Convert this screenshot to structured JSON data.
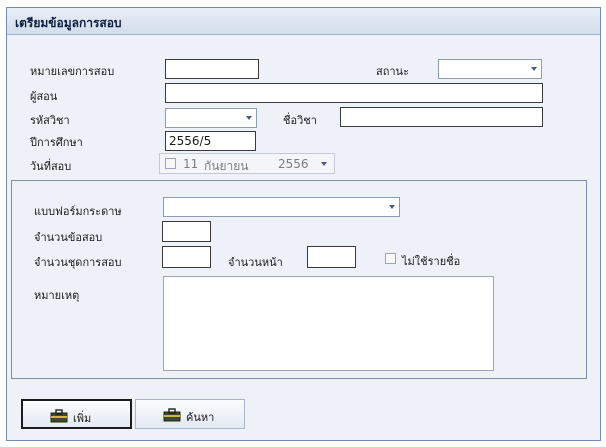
{
  "window": {
    "title": "เตรียมข้อมูลการสอบ"
  },
  "form": {
    "exam_no_label": "หมายเลขการสอบ",
    "exam_no_value": "",
    "status_label": "สถานะ",
    "status_value": "",
    "teacher_label": "ผู้สอน",
    "teacher_value": "",
    "subject_code_label": "รหัสวิชา",
    "subject_code_value": "",
    "subject_name_label": "ชื่อวิชา",
    "subject_name_value": "",
    "academic_year_label": "ปีการศึกษา",
    "academic_year_value": "2556/5",
    "exam_date_label": "วันที่สอบ",
    "exam_date": {
      "day": "11",
      "month": "กันยายน",
      "year": "2556",
      "checked": false
    }
  },
  "paper": {
    "paper_form_label": "แบบฟอร์มกระดาษ",
    "paper_form_value": "",
    "question_count_label": "จำนวนข้อสอบ",
    "question_count_value": "",
    "exam_sets_label": "จำนวนชุดการสอบ",
    "exam_sets_value": "",
    "page_count_label": "จำนวนหน้า",
    "page_count_value": "",
    "no_name_list_label": "ไม่ใช้รายชื่อ",
    "no_name_list_checked": false,
    "remark_label": "หมายเหตุ",
    "remark_value": ""
  },
  "buttons": {
    "add_label": "เพิ่ม",
    "search_label": "ค้นหา"
  },
  "icons": {
    "add": "toolbox-icon",
    "search": "toolbox-icon"
  }
}
